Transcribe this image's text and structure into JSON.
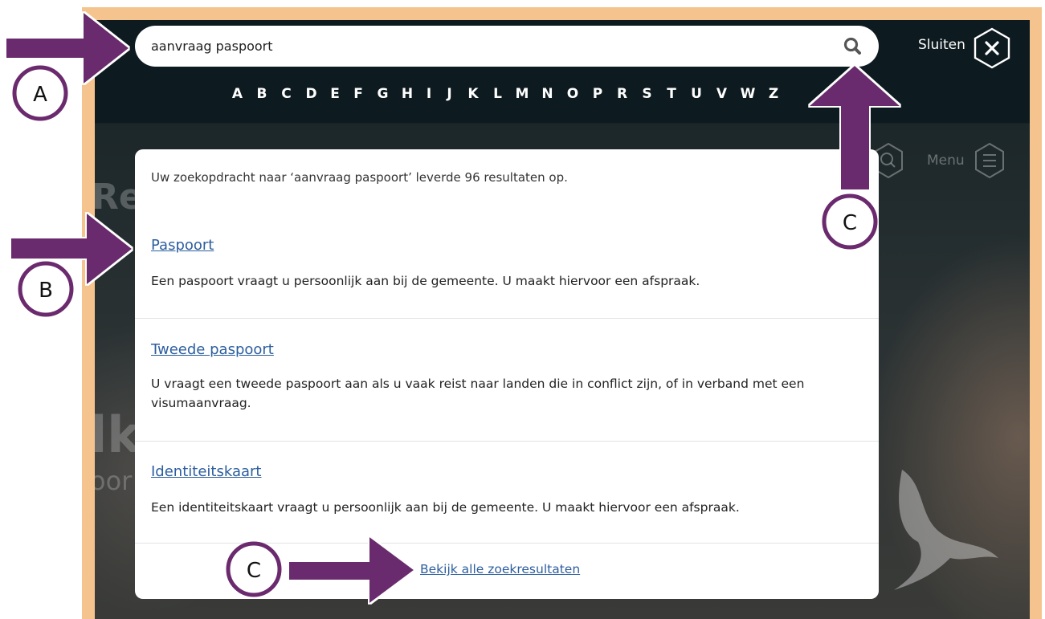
{
  "search": {
    "value": "aanvraag paspoort",
    "button_icon": "search-icon"
  },
  "header": {
    "close_label": "Sluiten",
    "close_icon": "close-icon",
    "menu_label": "Menu",
    "menu_icon": "hamburger-icon"
  },
  "alphabet": [
    "A",
    "B",
    "C",
    "D",
    "E",
    "F",
    "G",
    "H",
    "I",
    "J",
    "K",
    "L",
    "M",
    "N",
    "O",
    "P",
    "R",
    "S",
    "T",
    "U",
    "V",
    "W",
    "Z"
  ],
  "results": {
    "summary": "Uw zoekopdracht naar ‘aanvraag paspoort’ leverde 96 resultaten op.",
    "items": [
      {
        "title": "Paspoort",
        "description": "Een paspoort vraagt u persoonlijk aan bij de gemeente. U maakt hiervoor een afspraak."
      },
      {
        "title": "Tweede paspoort",
        "description": "U vraagt een tweede paspoort aan als u vaak reist naar landen die in conflict zijn, of in verband met een visumaanvraag."
      },
      {
        "title": "Identiteitskaart",
        "description": "Een identiteitskaart vraagt u persoonlijk aan bij de gemeente. U maakt hiervoor een afspraak."
      }
    ],
    "see_all": "Bekijk alle zoekresultaten"
  },
  "annotations": {
    "a": "A",
    "b": "B",
    "c_top": "C",
    "c_bottom": "C"
  },
  "colors": {
    "frame": "#f5c48e",
    "arrow": "#6b2a6e",
    "header_bg": "#0d1a1f",
    "link": "#2c5e9e"
  }
}
